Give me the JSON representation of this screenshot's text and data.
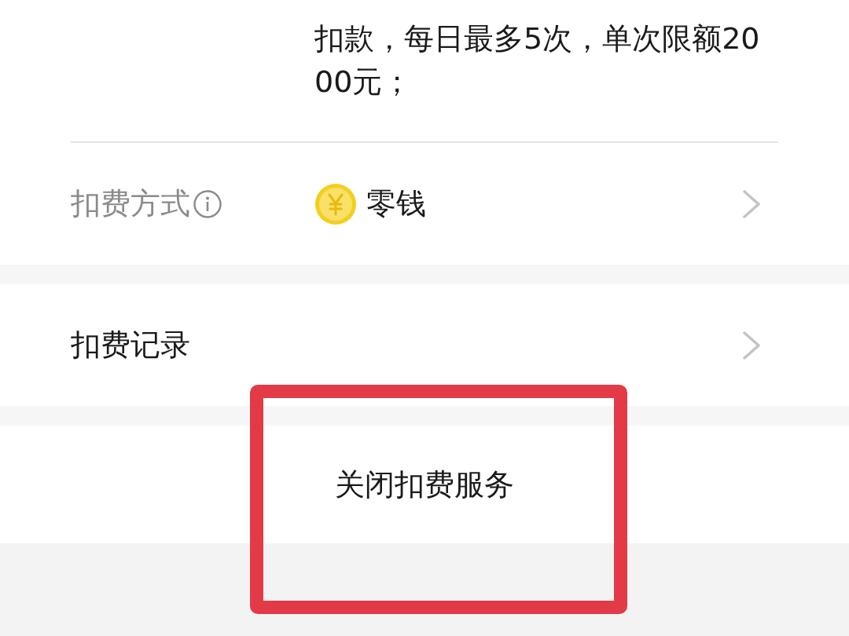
{
  "description": {
    "text": "扣款，每日最多5次，单次限额2000元；"
  },
  "rows": [
    {
      "kind": "method",
      "label": "扣费方式",
      "value": "零钱"
    },
    {
      "kind": "link",
      "label": "扣费记录"
    }
  ],
  "close_button": {
    "label": "关闭扣费服务"
  },
  "annotation": {
    "kind": "rectangle"
  }
}
